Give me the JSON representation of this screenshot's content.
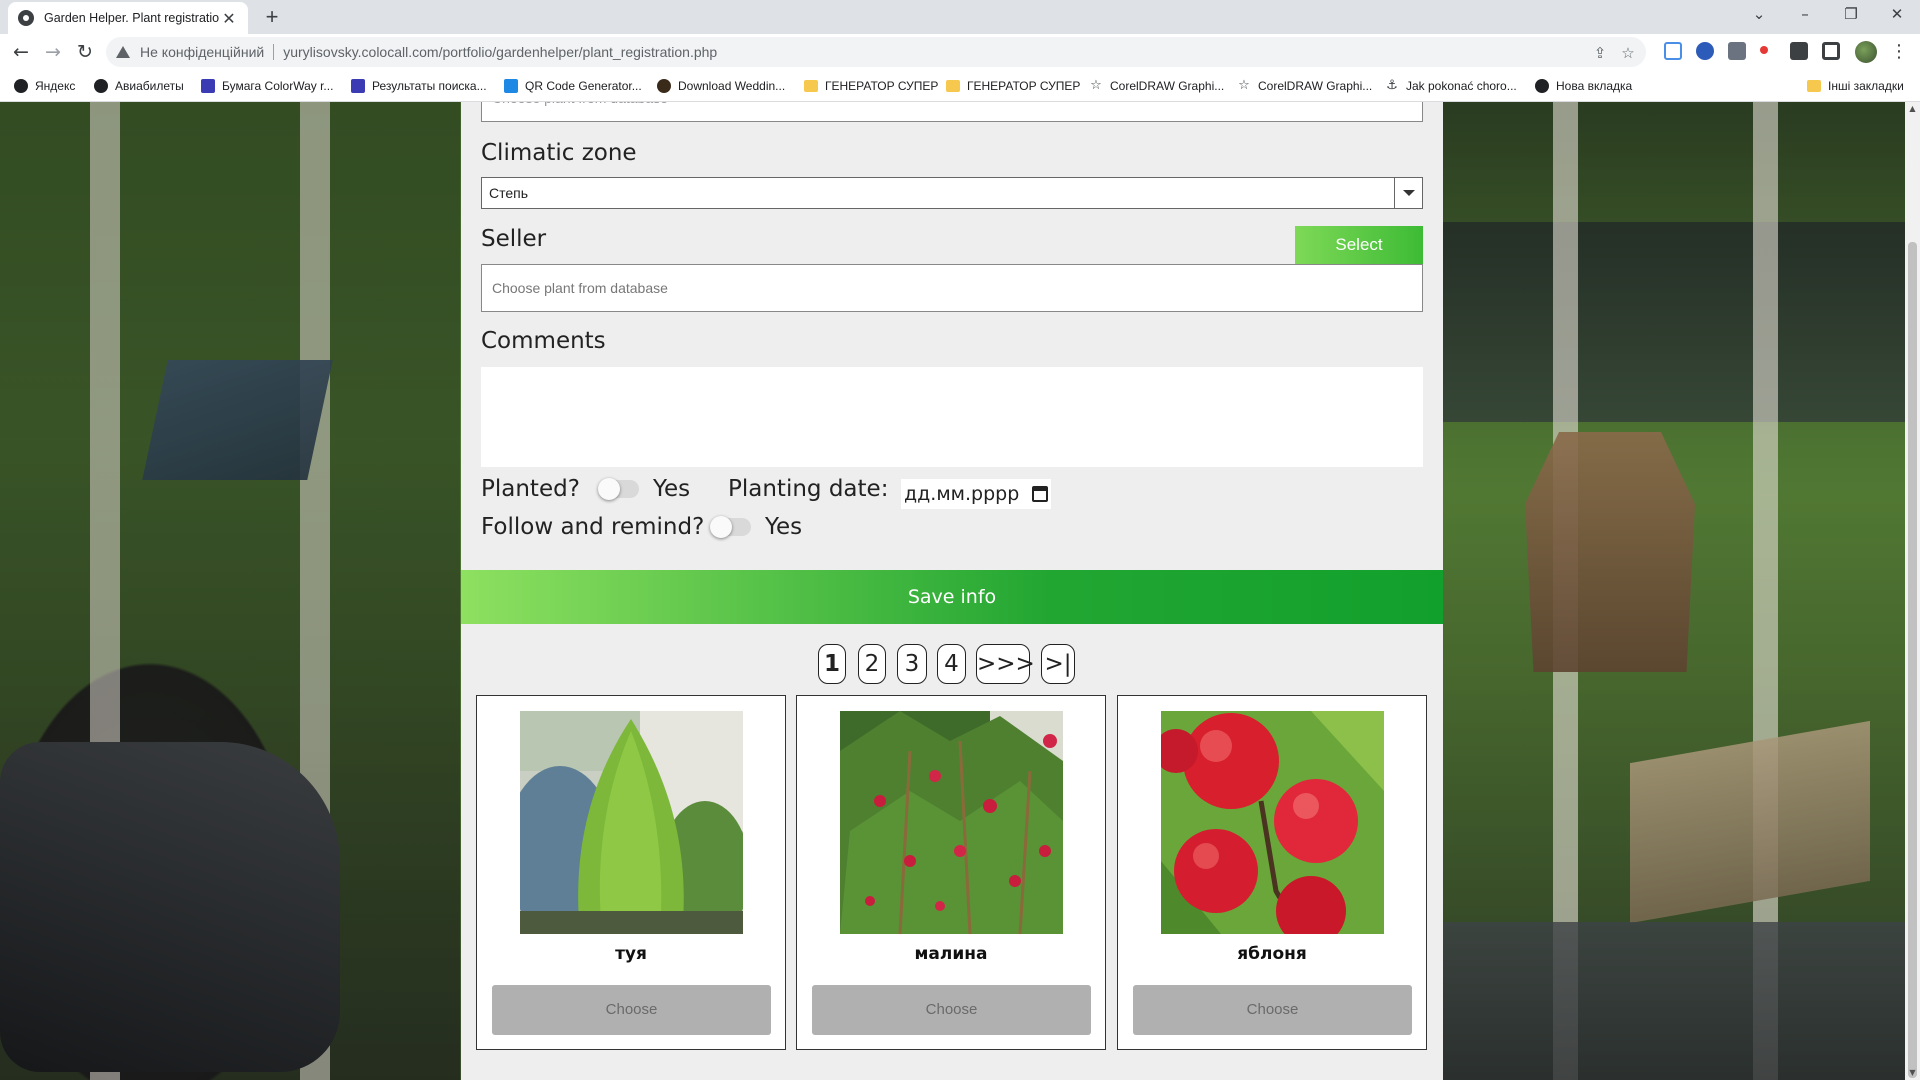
{
  "browser": {
    "tab_title": "Garden Helper. Plant registration",
    "security_label": "Не конфіденційний",
    "url": "yurylisovsky.colocall.com/portfolio/gardenhelper/plant_registration.php",
    "bookmarks": [
      {
        "label": "Яндекс",
        "icon": "yandex-icon"
      },
      {
        "label": "Авиабилеты",
        "icon": "globe-icon"
      },
      {
        "label": "Бумага ColorWay r...",
        "icon": "colorway-icon"
      },
      {
        "label": "Результаты поиска...",
        "icon": "colorway-icon"
      },
      {
        "label": "QR Code Generator...",
        "icon": "qr-icon"
      },
      {
        "label": "Download Weddin...",
        "icon": "globe-icon"
      },
      {
        "label": "ГЕНЕРАТОР СУПЕР",
        "icon": "folder-icon"
      },
      {
        "label": "ГЕНЕРАТОР СУПЕР",
        "icon": "folder-icon"
      },
      {
        "label": "CorelDRAW Graphi...",
        "icon": "star-icon"
      },
      {
        "label": "CorelDRAW Graphi...",
        "icon": "star-icon"
      },
      {
        "label": "Jak pokonać choro...",
        "icon": "anchor-icon"
      },
      {
        "label": "Нова вкладка",
        "icon": "globe-icon"
      }
    ],
    "other_bookmarks": "Інші закладки"
  },
  "form": {
    "top_field_placeholder": "Choose plant from database",
    "climatic_zone": {
      "label": "Climatic zone",
      "value": "Степь"
    },
    "seller": {
      "label": "Seller",
      "select_button": "Select",
      "placeholder": "Choose plant from database"
    },
    "comments": {
      "label": "Comments",
      "value": ""
    },
    "planted": {
      "label": "Planted?",
      "toggle_label": "Yes",
      "checked": false
    },
    "planting_date": {
      "label": "Planting date:",
      "value": "дд.мм.рррр"
    },
    "follow": {
      "label": "Follow and remind?",
      "toggle_label": "Yes",
      "checked": false
    },
    "save_button": "Save info"
  },
  "pagination": {
    "pages": [
      "1",
      "2",
      "3",
      "4"
    ],
    "current": "1",
    "next": ">>>",
    "last": ">|"
  },
  "plants": [
    {
      "name": "туя",
      "button": "Choose"
    },
    {
      "name": "малина",
      "button": "Choose"
    },
    {
      "name": "яблоня",
      "button": "Choose"
    }
  ],
  "colors": {
    "accent_green": "#3dbb35",
    "panel_bg": "#eeeeee",
    "choose_button": "#b0b0b0"
  }
}
